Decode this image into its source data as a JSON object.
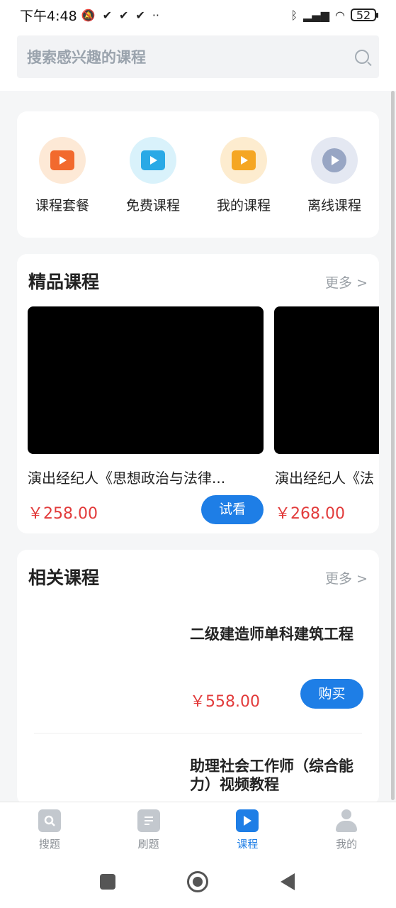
{
  "status_bar": {
    "time": "下午4:48",
    "battery": "52"
  },
  "search": {
    "placeholder": "搜索感兴趣的课程"
  },
  "quick_links": [
    {
      "label": "课程套餐",
      "icon": "course-package-icon",
      "bg": "#fde9d6",
      "fg": "#f26a2e"
    },
    {
      "label": "免费课程",
      "icon": "free-video-icon",
      "bg": "#d9f2fb",
      "fg": "#2aa9e6"
    },
    {
      "label": "我的课程",
      "icon": "tv-play-icon",
      "bg": "#fdeccf",
      "fg": "#f5a623"
    },
    {
      "label": "离线课程",
      "icon": "offline-play-icon",
      "bg": "#e4e8f2",
      "fg": "#98a6c4"
    }
  ],
  "featured": {
    "title": "精品课程",
    "more": "更多 >",
    "courses": [
      {
        "title": "演出经纪人《思想政治与法律...",
        "price": "￥258.00",
        "button": "试看"
      },
      {
        "title": "演出经纪人《法",
        "price": "￥268.00"
      }
    ]
  },
  "related": {
    "title": "相关课程",
    "more": "更多 >",
    "courses": [
      {
        "title": "二级建造师单科建筑工程",
        "price": "￥558.00",
        "button": "购买"
      },
      {
        "title": "助理社会工作师（综合能力）视频教程"
      }
    ]
  },
  "bottom_nav": [
    {
      "label": "搜题",
      "icon": "search-question-icon",
      "active": false
    },
    {
      "label": "刷题",
      "icon": "practice-icon",
      "active": false
    },
    {
      "label": "课程",
      "icon": "course-play-icon",
      "active": true
    },
    {
      "label": "我的",
      "icon": "profile-icon",
      "active": false
    }
  ],
  "colors": {
    "accent": "#1e7ee6",
    "price": "#e23b3b"
  }
}
